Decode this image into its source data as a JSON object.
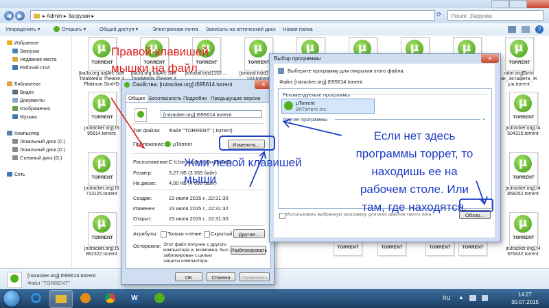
{
  "explorer": {
    "breadcrumb": [
      "Admin",
      "Загрузки"
    ],
    "search_placeholder": "Поиск: Загрузки",
    "toolbar": [
      "Упорядочить ▾",
      "Открыть ▾",
      "Общий доступ ▾",
      "Электронная почта",
      "Записать на оптический диск",
      "Новая папка"
    ],
    "sidebar": [
      {
        "label": "Избранное",
        "icon": "star-icon",
        "color": "#e7b21b",
        "header": true
      },
      {
        "label": "Загрузки",
        "icon": "downloads-folder-icon",
        "color": "#4f81bd"
      },
      {
        "label": "Недавние места",
        "icon": "recent-places-icon",
        "color": "#d9a441"
      },
      {
        "label": "Рабочий стол",
        "icon": "desktop-icon",
        "color": "#3f76b4"
      },
      {
        "label": "",
        "icon": "",
        "color": ""
      },
      {
        "label": "Библиотеки",
        "icon": "libraries-icon",
        "color": "#d9a441",
        "header": true
      },
      {
        "label": "Видео",
        "icon": "video-icon",
        "color": "#5c6c80"
      },
      {
        "label": "Документы",
        "icon": "documents-icon",
        "color": "#8aa7c6"
      },
      {
        "label": "Изображения",
        "icon": "pictures-icon",
        "color": "#6a9e4d"
      },
      {
        "label": "Музыка",
        "icon": "music-icon",
        "color": "#3f76b4"
      },
      {
        "label": "",
        "icon": "",
        "color": ""
      },
      {
        "label": "Компьютер",
        "icon": "computer-icon",
        "color": "#5c7fa8",
        "header": true
      },
      {
        "label": "Локальный диск (C:)",
        "icon": "drive-c-icon",
        "color": "#8a8a8a"
      },
      {
        "label": "Локальный диск (D:)",
        "icon": "drive-d-icon",
        "color": "#8a8a8a"
      },
      {
        "label": "Съемный диск (G:)",
        "icon": "removable-drive-icon",
        "color": "#8a8a8a"
      },
      {
        "label": "",
        "icon": "",
        "color": ""
      },
      {
        "label": "Сеть",
        "icon": "network-icon",
        "color": "#3f76b4",
        "header": true
      }
    ],
    "files_top": [
      "[ba3a.org.ua]Arc Soft TotalMedia Theatre 3 Platinum SimHD",
      "[ba3a.org.ua]Arc Soft TotalMedia Theatre 3",
      "[kinozal.tv]id1153 ...",
      "[kinozal.tv]id1323 133.torrent",
      "",
      "",
      "",
      "",
      "rutor.org]Битл ин_Эстафета_Ж у.ж.torrent"
    ],
    "files_left": [
      "[rutracker.org].t5 95614.torrent",
      "[rutracker.org].t5 713125.torrent",
      "[rutracker.org].t5 862322.torrent"
    ],
    "files_right": [
      "[rutracker.org].t4 504315.torrent",
      "[rutracker.org].t4 858252.torrent",
      "[rutracker.org].t4 976432.torrent"
    ],
    "torrent_label": "TORRENT",
    "details": {
      "name": "[rutracker.org].t595614.torrent",
      "type": "Файл \"TORRENT\""
    }
  },
  "properties": {
    "title": "Свойства: [rutracker.org].t595614.torrent",
    "tabs": [
      "Общие",
      "Безопасность",
      "Подробно",
      "Предыдущие версии"
    ],
    "filename": "[rutracker.org].t595614.torrent",
    "type_label": "Тип файла:",
    "type_value": "Файл \"TORRENT\" (.torrent)",
    "app_label": "Приложение:",
    "app_value": "µTorrent",
    "change_button": "Изменить...",
    "location_label": "Расположение:",
    "location_value": "C:\\Users\\Admin\\Downloads",
    "size_label": "Размер:",
    "size_value": "3,27 КБ (3 355 байт)",
    "disk_label": "На диске:",
    "disk_value": "4,00 КБ (4 096 байт)",
    "created_label": "Создан:",
    "created_value": "23 июля 2015 г., 22:31:30",
    "modified_label": "Изменен:",
    "modified_value": "23 июля 2015 г., 22:31:32",
    "opened_label": "Открыт:",
    "opened_value": "23 июля 2015 г., 22:31:30",
    "attrs_label": "Атрибуты:",
    "readonly_label": "Только чтение",
    "hidden_label": "Скрытый",
    "other_button": "Другие...",
    "warning_label": "Осторожно:",
    "warning_text": "Этот файл получен с другого компьютера и, возможно, был заблокирован с целью защиты компьютера.",
    "unblock_button": "Разблокировать",
    "ok": "OK",
    "cancel": "Отмена",
    "apply": "Применить"
  },
  "openwith": {
    "title": "Выбор программы",
    "prompt": "Выберите программу для открытия этого файла:",
    "file_label": "Файл:",
    "file_value": "[rutracker.org].t595614.torrent",
    "recommended_header": "Рекомендуемые программы",
    "program_name": "µTorrent",
    "program_vendor": "BitTorrent Inc.",
    "other_header": "Другие программы",
    "always_use": "Использовать выбранную программу для всех файлов такого типа",
    "browse_button": "Обзор..."
  },
  "annotations": {
    "red_line1": "Правой клавишей",
    "red_line2": "мышки на файл",
    "blue_click": "Жми левой клавишей мыши",
    "blue_hint": "Если нет здесь программы торрет, то находишь ее на рабочем столе. Или там, где находятся."
  },
  "taskbar": {
    "lang": "RU",
    "time": "14:27",
    "date": "30.07.2015"
  }
}
